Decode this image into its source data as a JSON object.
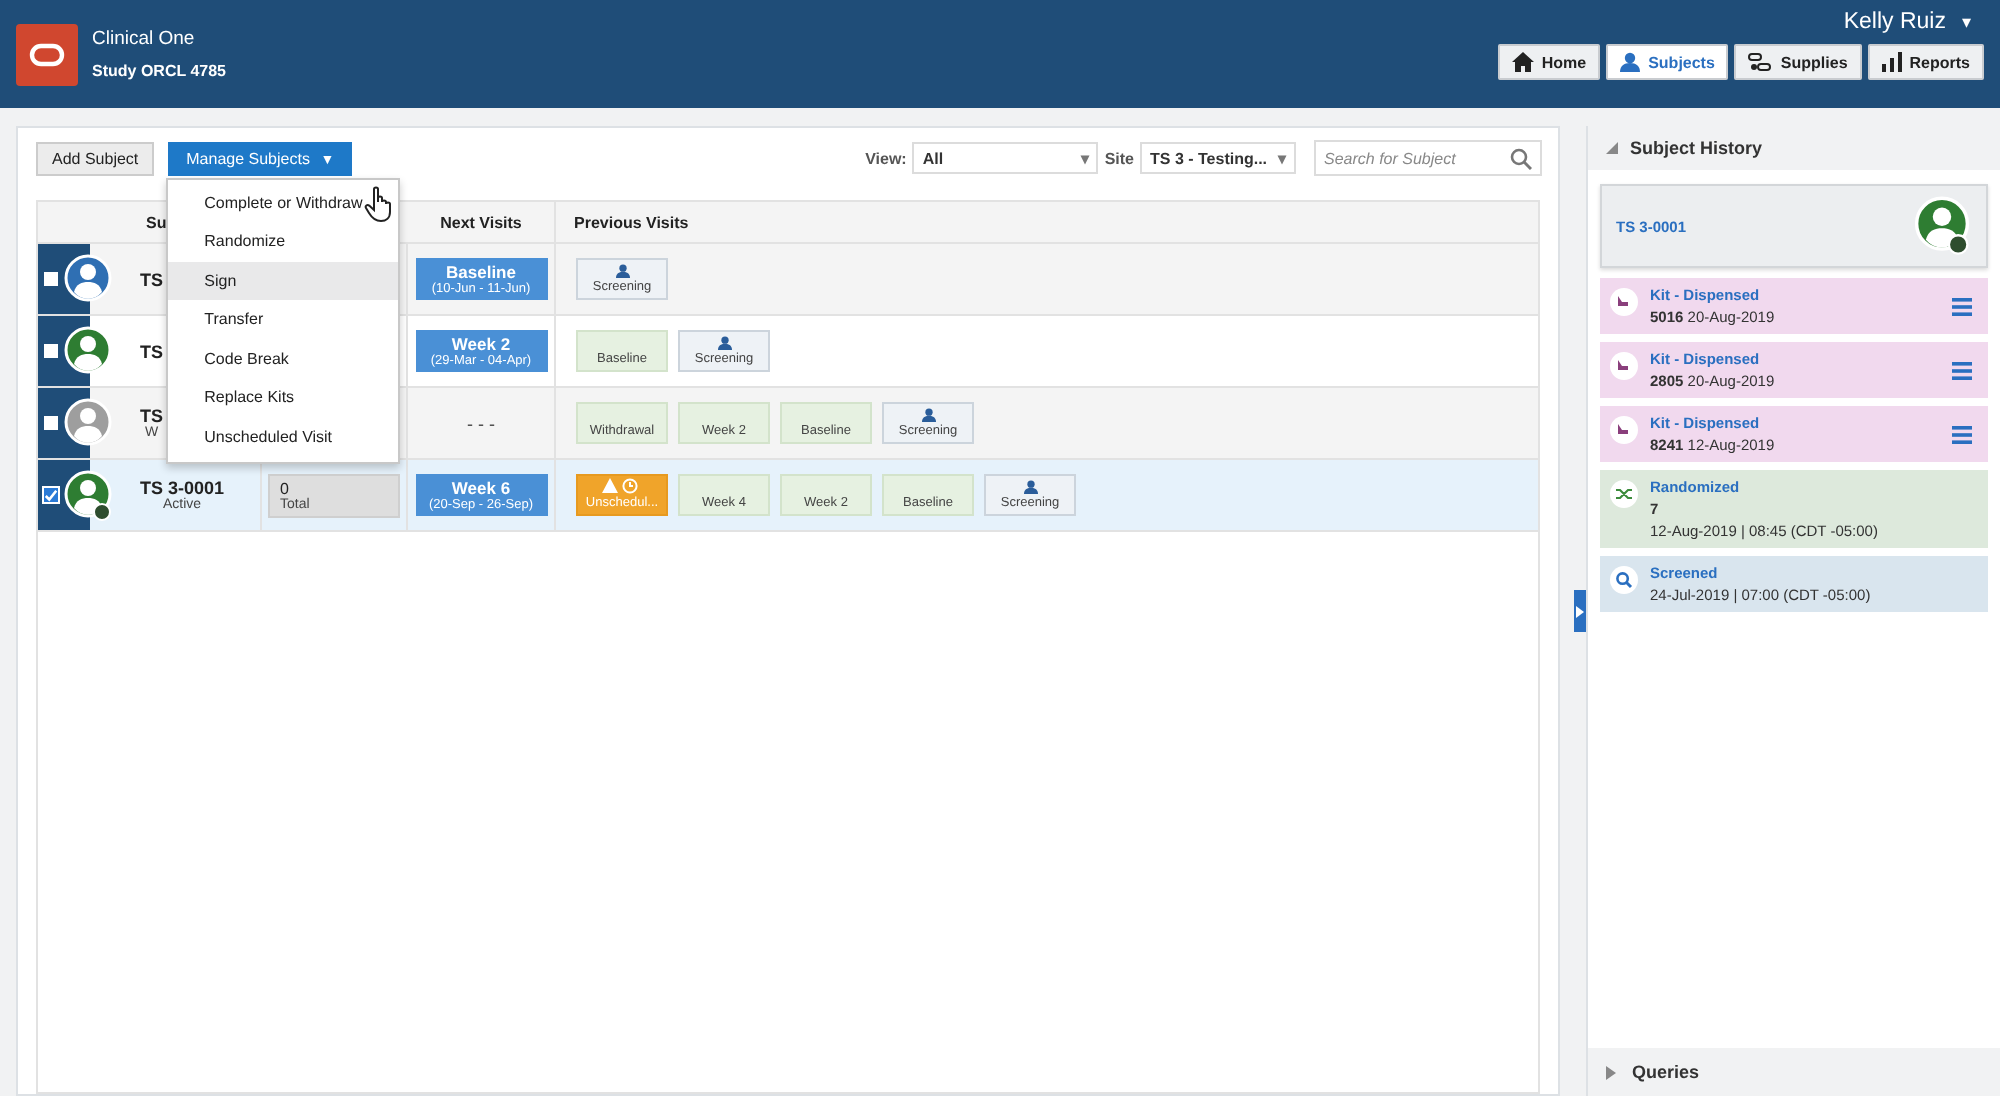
{
  "header": {
    "app_name": "Clinical One",
    "study": "Study ORCL 4785",
    "user": "Kelly Ruiz",
    "user_caret": "▾",
    "nav": [
      {
        "label": "Home",
        "selected": false
      },
      {
        "label": "Subjects",
        "selected": true
      },
      {
        "label": "Supplies",
        "selected": false
      },
      {
        "label": "Reports",
        "selected": false
      }
    ]
  },
  "toolbar": {
    "add_button": "Add Subject",
    "manage_button": "Manage Subjects",
    "manage_caret": "▼",
    "view_label": "View:",
    "view_value": "All",
    "view_caret": "▾",
    "site_label": "Site",
    "site_value": "TS 3 - Testing...",
    "site_caret": "▾",
    "search": {
      "placeholder": "Search for Subject"
    }
  },
  "menu": [
    {
      "label": "Complete or Withdraw",
      "selected": false
    },
    {
      "label": "Randomize",
      "selected": false
    },
    {
      "label": "Sign",
      "selected": true
    },
    {
      "label": "Transfer",
      "selected": false
    },
    {
      "label": "Code Break",
      "selected": false
    },
    {
      "label": "Replace Kits",
      "selected": false
    },
    {
      "label": "Unscheduled Visit",
      "selected": false
    }
  ],
  "table": {
    "columns": [
      "Su",
      "Next Visits",
      "Previous Visits"
    ],
    "rows": [
      {
        "checked": false,
        "color": "#2f6fb3",
        "badge": false,
        "subject": "TS",
        "next": {
          "kind": "visit",
          "title": "Baseline",
          "dates": "(10-Jun - 11-Jun)"
        },
        "previous": [
          {
            "kind": "screening",
            "label": "Screening"
          }
        ]
      },
      {
        "checked": false,
        "color": "#2e7d32",
        "badge": false,
        "subject": "TS",
        "next": {
          "kind": "visit",
          "title": "Week 2",
          "dates": "(29-Mar - 04-Apr)"
        },
        "previous": [
          {
            "kind": "done",
            "label": "Baseline"
          },
          {
            "kind": "screening",
            "label": "Screening"
          }
        ]
      },
      {
        "checked": false,
        "color": "#9e9e9e",
        "badge": false,
        "subject": "TS",
        "status": "W",
        "next": {
          "kind": "none",
          "text": "- - -"
        },
        "previous": [
          {
            "kind": "done",
            "label": "Withdrawal"
          },
          {
            "kind": "done",
            "label": "Week 2"
          },
          {
            "kind": "done",
            "label": "Baseline"
          },
          {
            "kind": "screening",
            "label": "Screening"
          }
        ]
      },
      {
        "checked": true,
        "color": "#2e7d32",
        "badge": true,
        "subject": "TS 3-0001",
        "status": "Active",
        "count": "0",
        "count_label": "Total",
        "next": {
          "kind": "visit",
          "title": "Week 6",
          "dates": "(20-Sep - 26-Sep)"
        },
        "previous": [
          {
            "kind": "unscheduled",
            "label": "Unschedul..."
          },
          {
            "kind": "done",
            "label": "Week 4"
          },
          {
            "kind": "done",
            "label": "Week 2"
          },
          {
            "kind": "done",
            "label": "Baseline"
          },
          {
            "kind": "screening",
            "label": "Screening"
          }
        ]
      }
    ]
  },
  "history": {
    "title": "Subject History",
    "subject": "TS 3-0001",
    "items": [
      {
        "kind": "kit",
        "title": "Kit - Dispensed",
        "line1": "**5016** 20-Aug-2019"
      },
      {
        "kind": "kit",
        "title": "Kit - Dispensed",
        "line1": "**2805** 20-Aug-2019"
      },
      {
        "kind": "kit",
        "title": "Kit - Dispensed",
        "line1": "**8241** 12-Aug-2019"
      },
      {
        "kind": "randomized",
        "title": "Randomized",
        "line1": "**7**",
        "line2": "12-Aug-2019 | 08:45 (CDT -05:00)"
      },
      {
        "kind": "screened",
        "title": "Screened",
        "line1": "24-Jul-2019 | 07:00 (CDT -05:00)"
      }
    ],
    "queries": "Queries"
  }
}
